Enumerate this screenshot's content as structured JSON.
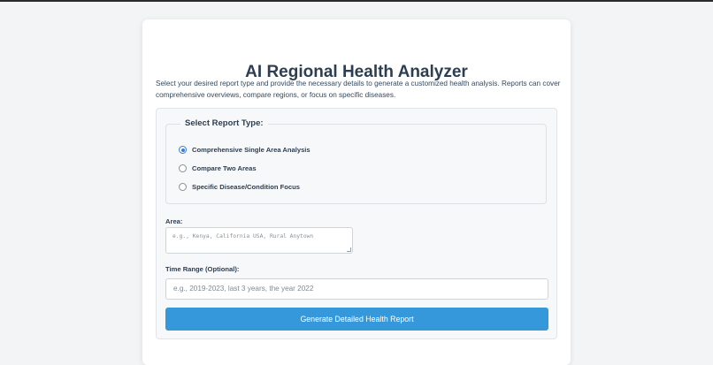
{
  "app": {
    "title": "AI Regional Health Analyzer",
    "intro": "Select your desired report type and provide the necessary details to generate a customized health analysis. Reports can cover comprehensive overviews, compare regions, or focus on specific diseases."
  },
  "report_type": {
    "legend": "Select Report Type:",
    "options": [
      {
        "label": "Comprehensive Single Area Analysis",
        "checked": true
      },
      {
        "label": "Compare Two Areas",
        "checked": false
      },
      {
        "label": "Specific Disease/Condition Focus",
        "checked": false
      }
    ]
  },
  "area": {
    "label": "Area:",
    "placeholder": "e.g., Kenya, California USA, Rural Anytown"
  },
  "time_range": {
    "label": "Time Range (Optional):",
    "placeholder": "e.g., 2019-2023, last 3 years, the year 2022"
  },
  "submit": {
    "label": "Generate Detailed Health Report"
  },
  "colors": {
    "accent": "#3498db",
    "heading": "#2c3e50",
    "background": "#f2f4f5"
  }
}
